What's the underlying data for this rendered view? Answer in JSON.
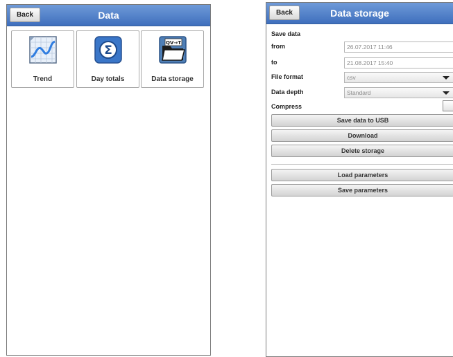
{
  "left_screen": {
    "back_label": "Back",
    "title": "Data",
    "tiles": [
      {
        "label": "Trend",
        "icon": "trend-icon"
      },
      {
        "label": "Day totals",
        "icon": "sigma-icon"
      },
      {
        "label": "Data storage",
        "icon": "data-storage-icon"
      }
    ],
    "storage_icon_text": "QV→T"
  },
  "right_screen": {
    "back_label": "Back",
    "title": "Data storage",
    "section_label": "Save data",
    "from": {
      "label": "from",
      "value": "26.07.2017 11:46"
    },
    "to": {
      "label": "to",
      "value": "21.08.2017 15:40"
    },
    "file_format": {
      "label": "File format",
      "value": "csv"
    },
    "data_depth": {
      "label": "Data depth",
      "value": "Standard"
    },
    "compress": {
      "label": "Compress",
      "checked": false
    },
    "buttons": {
      "save_usb": "Save data to USB",
      "download": "Download",
      "delete": "Delete storage",
      "load_params": "Load parameters",
      "save_params": "Save parameters"
    }
  },
  "colors": {
    "titlebar": "#4a78c4",
    "title_text": "#ffffff"
  }
}
